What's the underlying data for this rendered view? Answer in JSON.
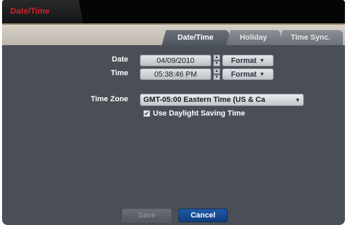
{
  "window": {
    "title": "Date/Time"
  },
  "tabs": [
    {
      "label": "Date/Time",
      "active": true
    },
    {
      "label": "Holiday",
      "active": false
    },
    {
      "label": "Time Sync.",
      "active": false
    }
  ],
  "date": {
    "label": "Date",
    "value": "04/09/2010",
    "format_button": "Format"
  },
  "time": {
    "label": "Time",
    "value": "05:38:46 PM",
    "format_button": "Format"
  },
  "timezone": {
    "label": "Time Zone",
    "value": "GMT-05:00  Eastern Time (US & Ca"
  },
  "dst": {
    "label": "Use Daylight Saving Time",
    "checked": true
  },
  "buttons": {
    "save": "Save",
    "cancel": "Cancel",
    "save_enabled": false
  },
  "colors": {
    "title_red": "#d4222a",
    "cancel_blue": "#1f5aa8",
    "panel": "#4a4f57"
  }
}
